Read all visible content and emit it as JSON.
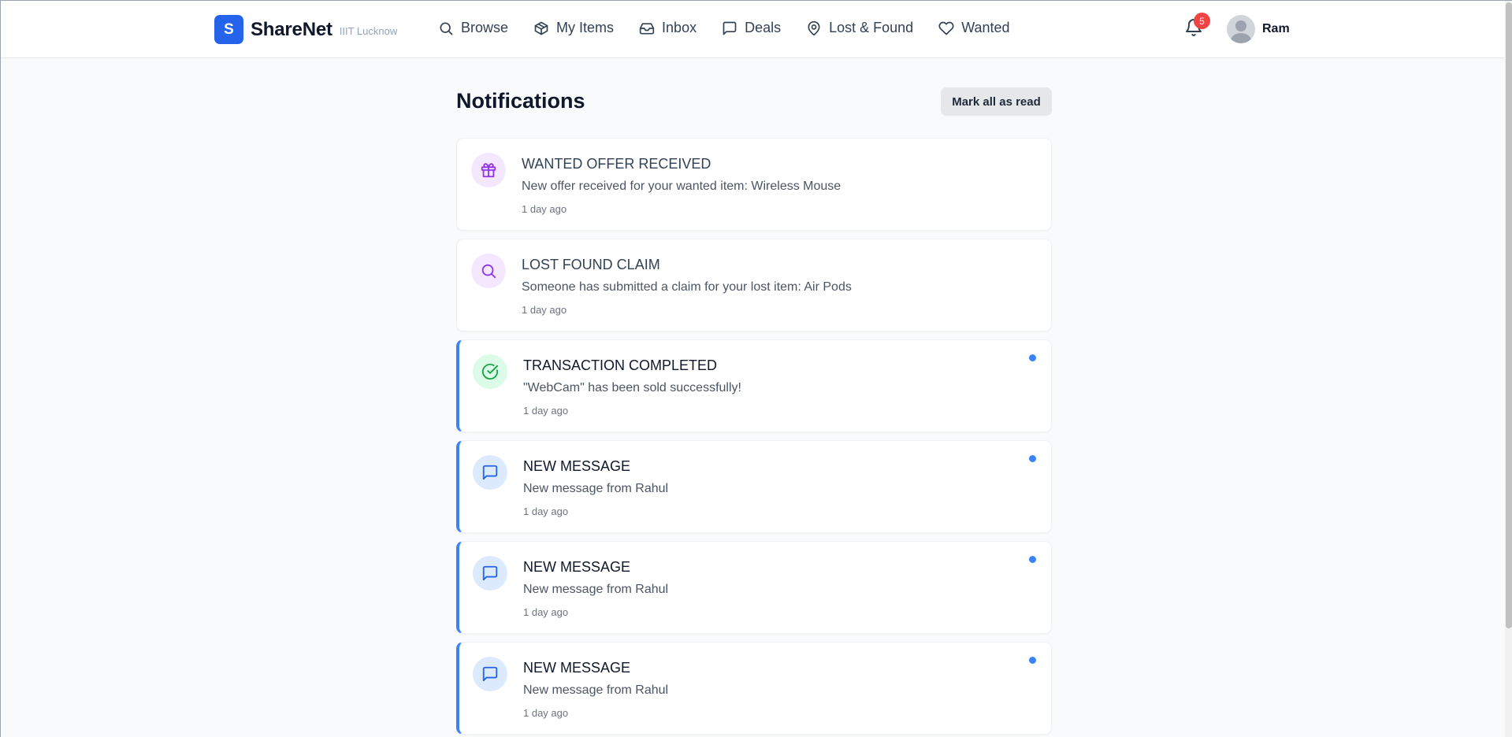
{
  "brand": {
    "logo_letter": "S",
    "name": "ShareNet",
    "subtitle": "IIIT Lucknow"
  },
  "nav": [
    {
      "label": "Browse",
      "icon": "search-icon"
    },
    {
      "label": "My Items",
      "icon": "package-icon"
    },
    {
      "label": "Inbox",
      "icon": "inbox-icon"
    },
    {
      "label": "Deals",
      "icon": "message-square-icon"
    },
    {
      "label": "Lost & Found",
      "icon": "map-pin-icon"
    },
    {
      "label": "Wanted",
      "icon": "heart-icon"
    }
  ],
  "header": {
    "notification_count": "5",
    "user_name": "Ram"
  },
  "main": {
    "title": "Notifications",
    "mark_all_label": "Mark all as read"
  },
  "notifications": [
    {
      "title": "WANTED OFFER RECEIVED",
      "message": "New offer received for your wanted item: Wireless Mouse",
      "time": "1 day ago",
      "unread": false,
      "icon": "gift-icon",
      "icon_color": "#9333ea",
      "icon_bg": "#f3e8ff"
    },
    {
      "title": "LOST FOUND CLAIM",
      "message": "Someone has submitted a claim for your lost item: Air Pods",
      "time": "1 day ago",
      "unread": false,
      "icon": "search-icon",
      "icon_color": "#9333ea",
      "icon_bg": "#f3e8ff"
    },
    {
      "title": "TRANSACTION COMPLETED",
      "message": "\"WebCam\" has been sold successfully!",
      "time": "1 day ago",
      "unread": true,
      "icon": "check-circle-icon",
      "icon_color": "#16a34a",
      "icon_bg": "#dcfce7"
    },
    {
      "title": "NEW MESSAGE",
      "message": "New message from Rahul",
      "time": "1 day ago",
      "unread": true,
      "icon": "message-square-icon",
      "icon_color": "#2563eb",
      "icon_bg": "#dbeafe"
    },
    {
      "title": "NEW MESSAGE",
      "message": "New message from Rahul",
      "time": "1 day ago",
      "unread": true,
      "icon": "message-square-icon",
      "icon_color": "#2563eb",
      "icon_bg": "#dbeafe"
    },
    {
      "title": "NEW MESSAGE",
      "message": "New message from Rahul",
      "time": "1 day ago",
      "unread": true,
      "icon": "message-square-icon",
      "icon_color": "#2563eb",
      "icon_bg": "#dbeafe"
    }
  ],
  "colors": {
    "accent": "#2563eb",
    "unread_border": "#3b82f6",
    "badge": "#ef4444"
  }
}
